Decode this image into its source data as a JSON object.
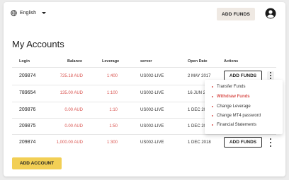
{
  "header": {
    "language": "English",
    "add_funds_label": "ADD FUNDS"
  },
  "page_title": "My Accounts",
  "table": {
    "columns": [
      "Login",
      "Balance",
      "Leverage",
      "server",
      "Open Date",
      "Actions"
    ],
    "rows": [
      {
        "login": "209874",
        "balance": "725.18 AUD",
        "leverage": "1:400",
        "server": "US002-LIVE",
        "open_date": "2 MAY 2017",
        "action": "ADD FUNDS"
      },
      {
        "login": "789654",
        "balance": "135.00 AUD",
        "leverage": "1:100",
        "server": "US002-LIVE",
        "open_date": "16 JUN 2",
        "action": ""
      },
      {
        "login": "209876",
        "balance": "0.00 AUD",
        "leverage": "1:10",
        "server": "US002-LIVE",
        "open_date": "1 DEC 20",
        "action": ""
      },
      {
        "login": "209875",
        "balance": "0.00 AUD",
        "leverage": "1:50",
        "server": "US002-LIVE",
        "open_date": "1 DEC 20",
        "action": ""
      },
      {
        "login": "209874",
        "balance": "1,000.00 AUD",
        "leverage": "1:300",
        "server": "US002-LIVE",
        "open_date": "1 DEC 2018",
        "action": "ADD FUNDS"
      }
    ]
  },
  "actions_menu": {
    "items": [
      "Transfer Funds",
      "Withdraw Funds",
      "Change Leverage",
      "Change MT4 password",
      "Financial Statements"
    ],
    "active_item": "Withdraw Funds"
  },
  "add_account_label": "ADD ACCOUNT",
  "colors": {
    "accent_red": "#d9534f",
    "accent_yellow": "#f2cf55",
    "top_button_bg": "#efe9e3"
  }
}
